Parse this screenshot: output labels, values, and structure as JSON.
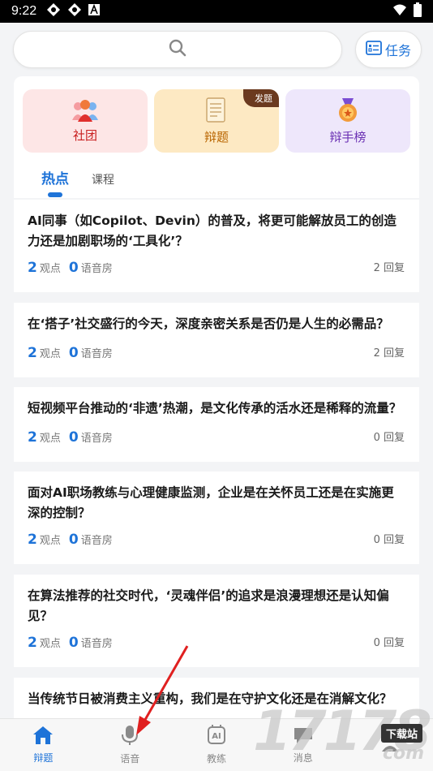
{
  "status": {
    "time": "9:22"
  },
  "search": {
    "placeholder": ""
  },
  "task_button": {
    "label": "任务"
  },
  "tiles": [
    {
      "label": "社团",
      "icon": "group-icon"
    },
    {
      "label": "辩题",
      "icon": "document-icon",
      "badge": "发题"
    },
    {
      "label": "辩手榜",
      "icon": "medal-icon"
    }
  ],
  "tabs": [
    {
      "label": "热点",
      "active": true
    },
    {
      "label": "课程",
      "active": false
    }
  ],
  "posts": [
    {
      "title": "AI同事（如Copilot、Devin）的普及，将更可能解放员工的创造力还是加剧职场的‘工具化’？",
      "views": "2",
      "views_label": "观点",
      "rooms": "0",
      "rooms_label": "语音房",
      "replies": "2 回复"
    },
    {
      "title": "在‘搭子’社交盛行的今天，深度亲密关系是否仍是人生的必需品？",
      "views": "2",
      "views_label": "观点",
      "rooms": "0",
      "rooms_label": "语音房",
      "replies": "2 回复"
    },
    {
      "title": "短视频平台推动的‘非遗’热潮，是文化传承的活水还是稀释的流量？",
      "views": "2",
      "views_label": "观点",
      "rooms": "0",
      "rooms_label": "语音房",
      "replies": "0 回复"
    },
    {
      "title": "面对AI职场教练与心理健康监测，企业是在关怀员工还是在实施更深的控制？",
      "views": "2",
      "views_label": "观点",
      "rooms": "0",
      "rooms_label": "语音房",
      "replies": "0 回复"
    },
    {
      "title": "在算法推荐的社交时代，‘灵魂伴侣’的追求是浪漫理想还是认知偏见？",
      "views": "2",
      "views_label": "观点",
      "rooms": "0",
      "rooms_label": "语音房",
      "replies": "0 回复"
    },
    {
      "title": "当传统节日被消费主义重构，我们是在守护文化还是在消解文化？"
    }
  ],
  "tabbar": [
    {
      "label": "辩题",
      "icon": "home-icon",
      "active": true
    },
    {
      "label": "语音",
      "icon": "microphone-icon",
      "active": false
    },
    {
      "label": "教练",
      "icon": "ai-coach-icon",
      "active": false
    },
    {
      "label": "消息",
      "icon": "message-icon",
      "active": false
    },
    {
      "label": "",
      "icon": "profile-icon",
      "active": false
    }
  ],
  "watermark": {
    "digits": "17178",
    "box": "下载站",
    "com": "com"
  },
  "colors": {
    "accent": "#1e73d8",
    "annotation": "#e02020"
  }
}
